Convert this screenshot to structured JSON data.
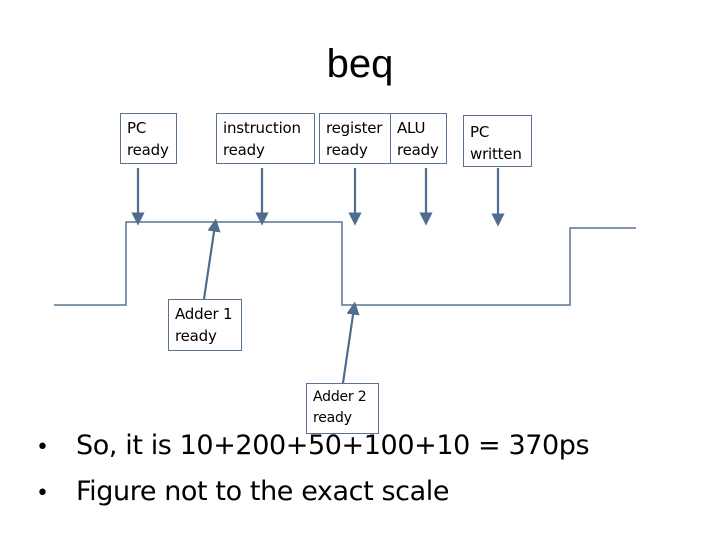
{
  "title": "beq",
  "labels": {
    "pc_ready": [
      "PC",
      "ready"
    ],
    "instruction_ready": [
      "instruction",
      "ready"
    ],
    "register_ready": [
      "register",
      "ready"
    ],
    "alu_ready": [
      "ALU",
      "ready"
    ],
    "pc_written": [
      "PC",
      "written"
    ],
    "adder1_ready": [
      "Adder 1",
      "ready"
    ],
    "adder2_ready": [
      "Adder 2",
      "ready"
    ]
  },
  "bullets": [
    "So, it is 10+200+50+100+10 = 370ps",
    "Figure not to the exact scale"
  ],
  "colors": {
    "line": "#5b7390",
    "arrow": "#4f6d8f",
    "text": "#000000"
  }
}
